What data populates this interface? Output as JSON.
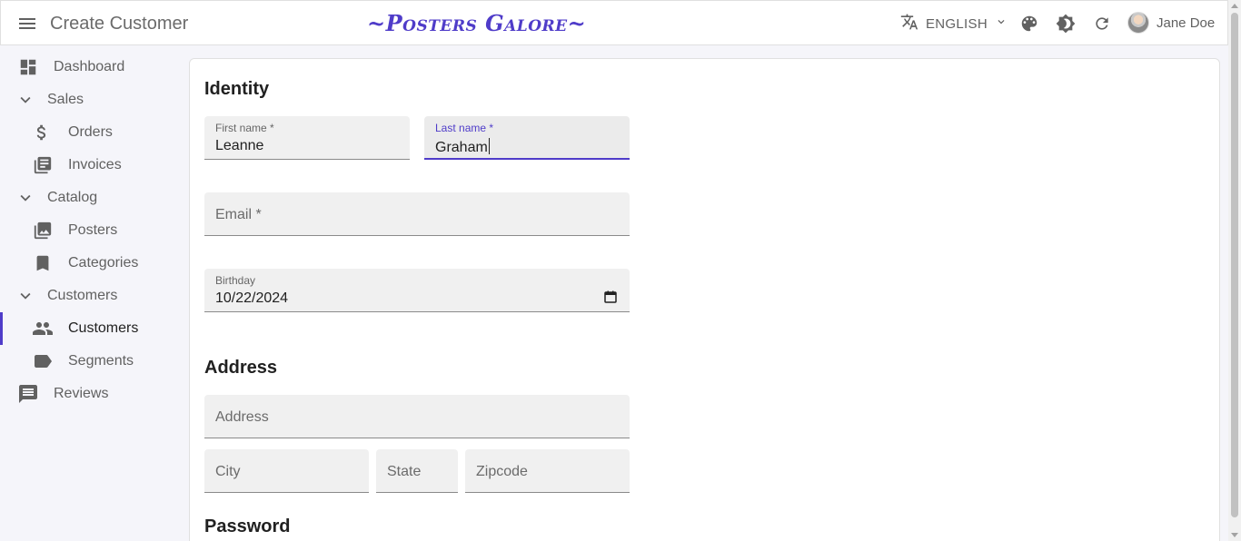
{
  "app": {
    "title": "Create Customer",
    "brand": "~Posters Galore~",
    "language": "ENGLISH",
    "user_name": "Jane Doe"
  },
  "sidebar": {
    "items": [
      {
        "label": "Dashboard",
        "icon": "dashboard-icon"
      },
      {
        "label": "Sales",
        "icon": "chevron-down-icon"
      },
      {
        "label": "Orders",
        "icon": "dollar-icon"
      },
      {
        "label": "Invoices",
        "icon": "library-books-icon"
      },
      {
        "label": "Catalog",
        "icon": "chevron-down-icon"
      },
      {
        "label": "Posters",
        "icon": "collections-icon"
      },
      {
        "label": "Categories",
        "icon": "bookmark-icon"
      },
      {
        "label": "Customers",
        "icon": "chevron-down-icon"
      },
      {
        "label": "Customers",
        "icon": "people-icon"
      },
      {
        "label": "Segments",
        "icon": "label-icon"
      },
      {
        "label": "Reviews",
        "icon": "comment-icon"
      }
    ]
  },
  "form": {
    "identity_title": "Identity",
    "first_name_label": "First name *",
    "first_name_value": "Leanne",
    "last_name_label": "Last name *",
    "last_name_value": "Graham",
    "email_placeholder": "Email *",
    "birthday_label": "Birthday",
    "birthday_value": "10/22/2024",
    "address_title": "Address",
    "address_placeholder": "Address",
    "city_placeholder": "City",
    "state_placeholder": "State",
    "zipcode_placeholder": "Zipcode",
    "password_title": "Password"
  },
  "colors": {
    "accent": "#4f3cc9",
    "background": "#f5f5fa",
    "field_bg": "#f0f0f0"
  }
}
